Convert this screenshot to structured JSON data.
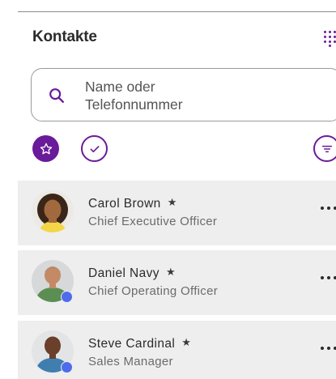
{
  "header": {
    "title": "Kontakte",
    "dialpad_icon": "dialpad-icon"
  },
  "search": {
    "placeholder": "Name oder Telefonnummer",
    "icon": "search-icon"
  },
  "filters": {
    "favorites_icon": "star-icon",
    "checked_icon": "check-circle-icon",
    "sort_icon": "filter-lines-icon"
  },
  "colors": {
    "accent": "#6a1b9a",
    "row_background": "#eeeeee",
    "presence_available": "#4f6bed"
  },
  "contacts": [
    {
      "name": "Carol Brown",
      "role": "Chief Executive Officer",
      "favorite": true,
      "presence": false
    },
    {
      "name": "Daniel Navy",
      "role": "Chief Operating Officer",
      "favorite": true,
      "presence": true
    },
    {
      "name": "Steve Cardinal",
      "role": "Sales Manager",
      "favorite": true,
      "presence": true
    }
  ]
}
